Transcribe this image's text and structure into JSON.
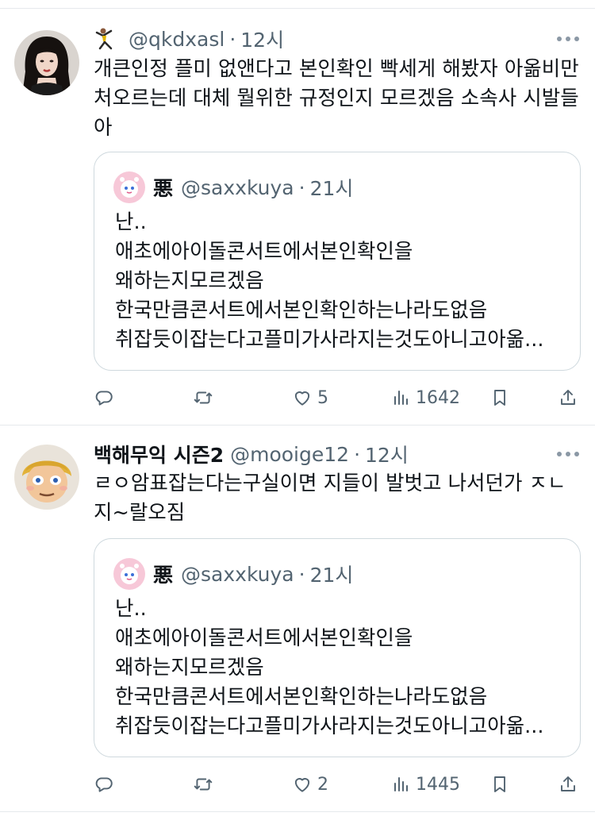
{
  "tweets": [
    {
      "author_emoji": "figure-gymnast-icon",
      "handle": "@qkdxasl",
      "dot": "·",
      "time": "12시",
      "text": "개큰인정 플미 없앤다고 본인확인 빡세게 해봤자 아옮비만 처오르는데 대체 뭘위한 규정인지 모르겠음 소속사 시발들아",
      "quote": {
        "name": "悪",
        "handle": "@saxxkuya",
        "dot": "·",
        "time": "21시",
        "lines": [
          "난..",
          "애초에아이돌콘서트에서본인확인을",
          "왜하는지모르겠음",
          "한국만큼콘서트에서본인확인하는나라도없음",
          "취잡듯이잡는다고플미가사라지는것도아니고아옮..."
        ]
      },
      "actions": {
        "reply": "",
        "retweet": "",
        "like": "5",
        "views": "1642"
      }
    },
    {
      "name": "백해무익 시즌2",
      "handle": "@mooige12",
      "dot": "·",
      "time": "12시",
      "text": "ㄹㅇ암표잡는다는구실이면 지들이 발벗고 나서던가 ㅈㄴ 지~랄오짐",
      "quote": {
        "name": "悪",
        "handle": "@saxxkuya",
        "dot": "·",
        "time": "21시",
        "lines": [
          "난..",
          "애초에아이돌콘서트에서본인확인을",
          "왜하는지모르겠음",
          "한국만큼콘서트에서본인확인하는나라도없음",
          "취잡듯이잡는다고플미가사라지는것도아니고아옮..."
        ]
      },
      "actions": {
        "reply": "",
        "retweet": "",
        "like": "2",
        "views": "1445"
      }
    }
  ],
  "colors": {
    "text": "#0f1419",
    "secondary": "#536471",
    "border": "#cfd9de",
    "divider": "#e6e9ec"
  }
}
